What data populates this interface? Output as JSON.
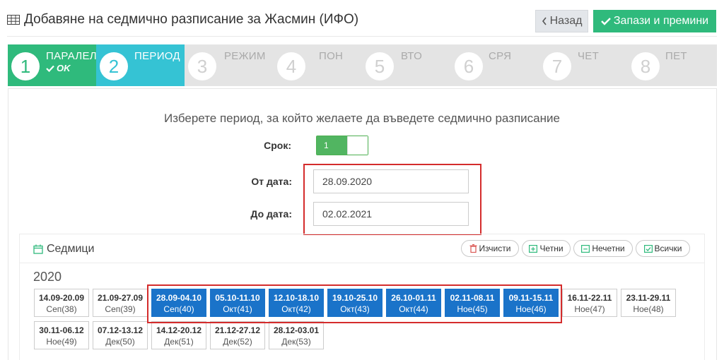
{
  "header": {
    "title": "Добавяне на седмично разписание за Жасмин (ИФО)",
    "back_label": "Назад",
    "save_label": "Запази и премини"
  },
  "wizard": {
    "steps": [
      {
        "num": "1",
        "label": "ПАРАЛЕЛ",
        "status": "OK"
      },
      {
        "num": "2",
        "label": "ПЕРИОД"
      },
      {
        "num": "3",
        "label": "РЕЖИМ"
      },
      {
        "num": "4",
        "label": "ПОН"
      },
      {
        "num": "5",
        "label": "ВТО"
      },
      {
        "num": "6",
        "label": "СРЯ"
      },
      {
        "num": "7",
        "label": "ЧЕТ"
      },
      {
        "num": "8",
        "label": "ПЕТ"
      }
    ]
  },
  "form": {
    "prompt": "Изберете период, за който желаете да въведете седмично разписание",
    "term_label": "Срок:",
    "term_value": "1",
    "from_label": "От дата:",
    "from_value": "28.09.2020",
    "to_label": "До дата:",
    "to_value": "02.02.2021"
  },
  "weeks": {
    "title": "Седмици",
    "buttons": {
      "clear": "Изчисти",
      "even": "Четни",
      "odd": "Нечетни",
      "all": "Всички"
    },
    "year": "2020",
    "items": [
      {
        "range": "14.09-20.09",
        "label": "Сеп(38)",
        "selected": false
      },
      {
        "range": "21.09-27.09",
        "label": "Сеп(39)",
        "selected": false
      },
      {
        "range": "28.09-04.10",
        "label": "Сеп(40)",
        "selected": true
      },
      {
        "range": "05.10-11.10",
        "label": "Окт(41)",
        "selected": true
      },
      {
        "range": "12.10-18.10",
        "label": "Окт(42)",
        "selected": true
      },
      {
        "range": "19.10-25.10",
        "label": "Окт(43)",
        "selected": true
      },
      {
        "range": "26.10-01.11",
        "label": "Окт(44)",
        "selected": true
      },
      {
        "range": "02.11-08.11",
        "label": "Ное(45)",
        "selected": true
      },
      {
        "range": "09.11-15.11",
        "label": "Ное(46)",
        "selected": true
      },
      {
        "range": "16.11-22.11",
        "label": "Ное(47)",
        "selected": false
      },
      {
        "range": "23.11-29.11",
        "label": "Ное(48)",
        "selected": false
      },
      {
        "range": "30.11-06.12",
        "label": "Ное(49)",
        "selected": false
      },
      {
        "range": "07.12-13.12",
        "label": "Дек(50)",
        "selected": false
      },
      {
        "range": "14.12-20.12",
        "label": "Дек(51)",
        "selected": false
      },
      {
        "range": "21.12-27.12",
        "label": "Дек(52)",
        "selected": false
      },
      {
        "range": "28.12-03.01",
        "label": "Дек(53)",
        "selected": false
      }
    ]
  },
  "colors": {
    "success": "#2fba7c",
    "active_step": "#35c3d4",
    "selected_week": "#1a73c9",
    "highlight": "#d42c2c"
  }
}
